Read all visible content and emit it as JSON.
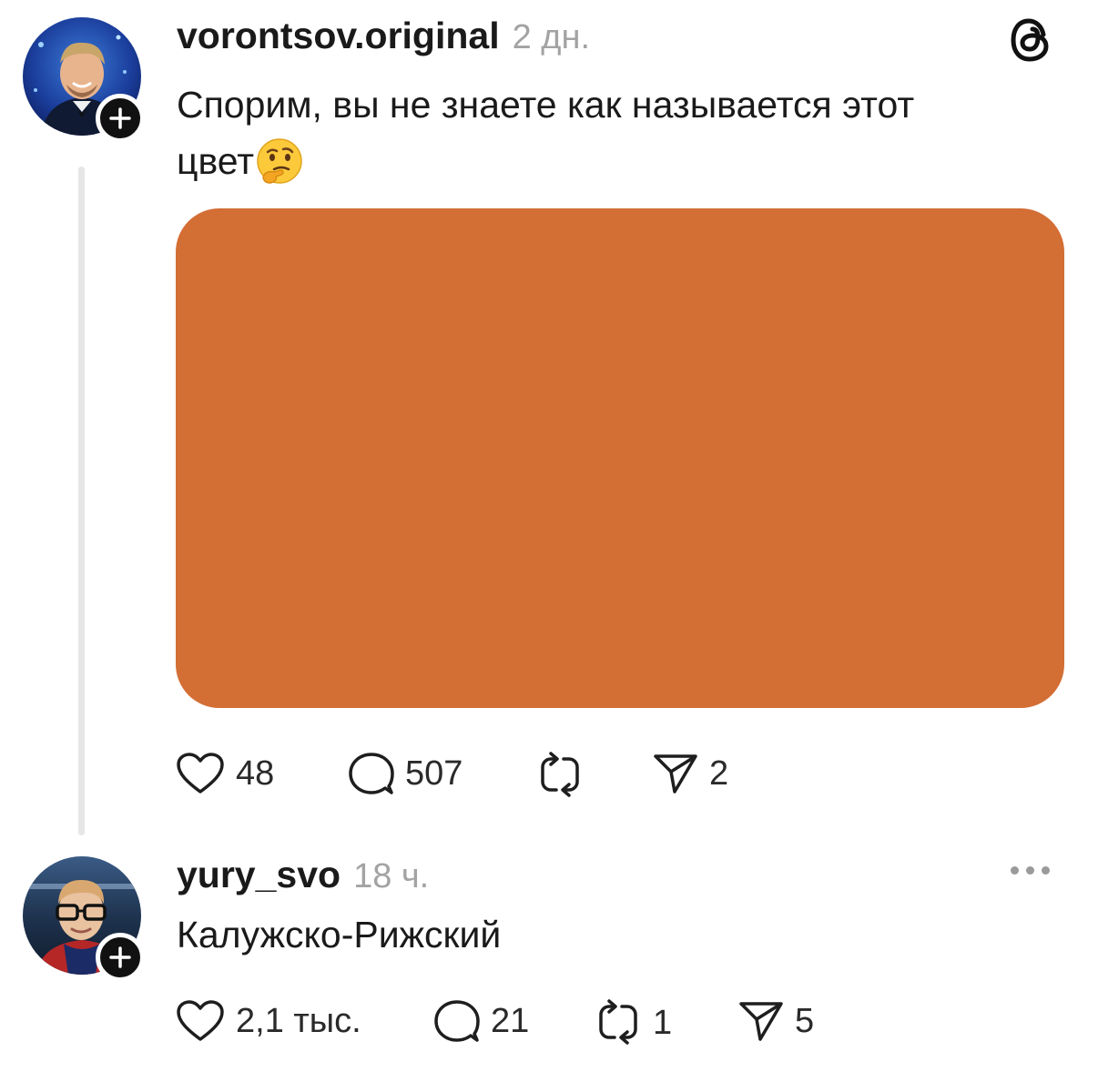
{
  "post": {
    "username": "vorontsov.original",
    "time": "2 дн.",
    "text_line1": "Спорим, вы не знаете как называется этот",
    "text_line2": "цвет",
    "emoji_icon": "thinking-face-emoji",
    "media_color": "#d36e35",
    "likes": "48",
    "comments": "507",
    "shares": "2"
  },
  "reply": {
    "username": "yury_svo",
    "time": "18 ч.",
    "text": "Калужско-Рижский",
    "likes": "2,1 тыс.",
    "comments": "21",
    "reposts": "1",
    "shares": "5"
  },
  "icons": {
    "logo": "threads-logo-icon",
    "follow": "plus-icon",
    "like": "heart-icon",
    "comment": "comment-bubble-icon",
    "repost": "repost-icon",
    "share": "send-icon",
    "more": "more-dots-icon"
  }
}
